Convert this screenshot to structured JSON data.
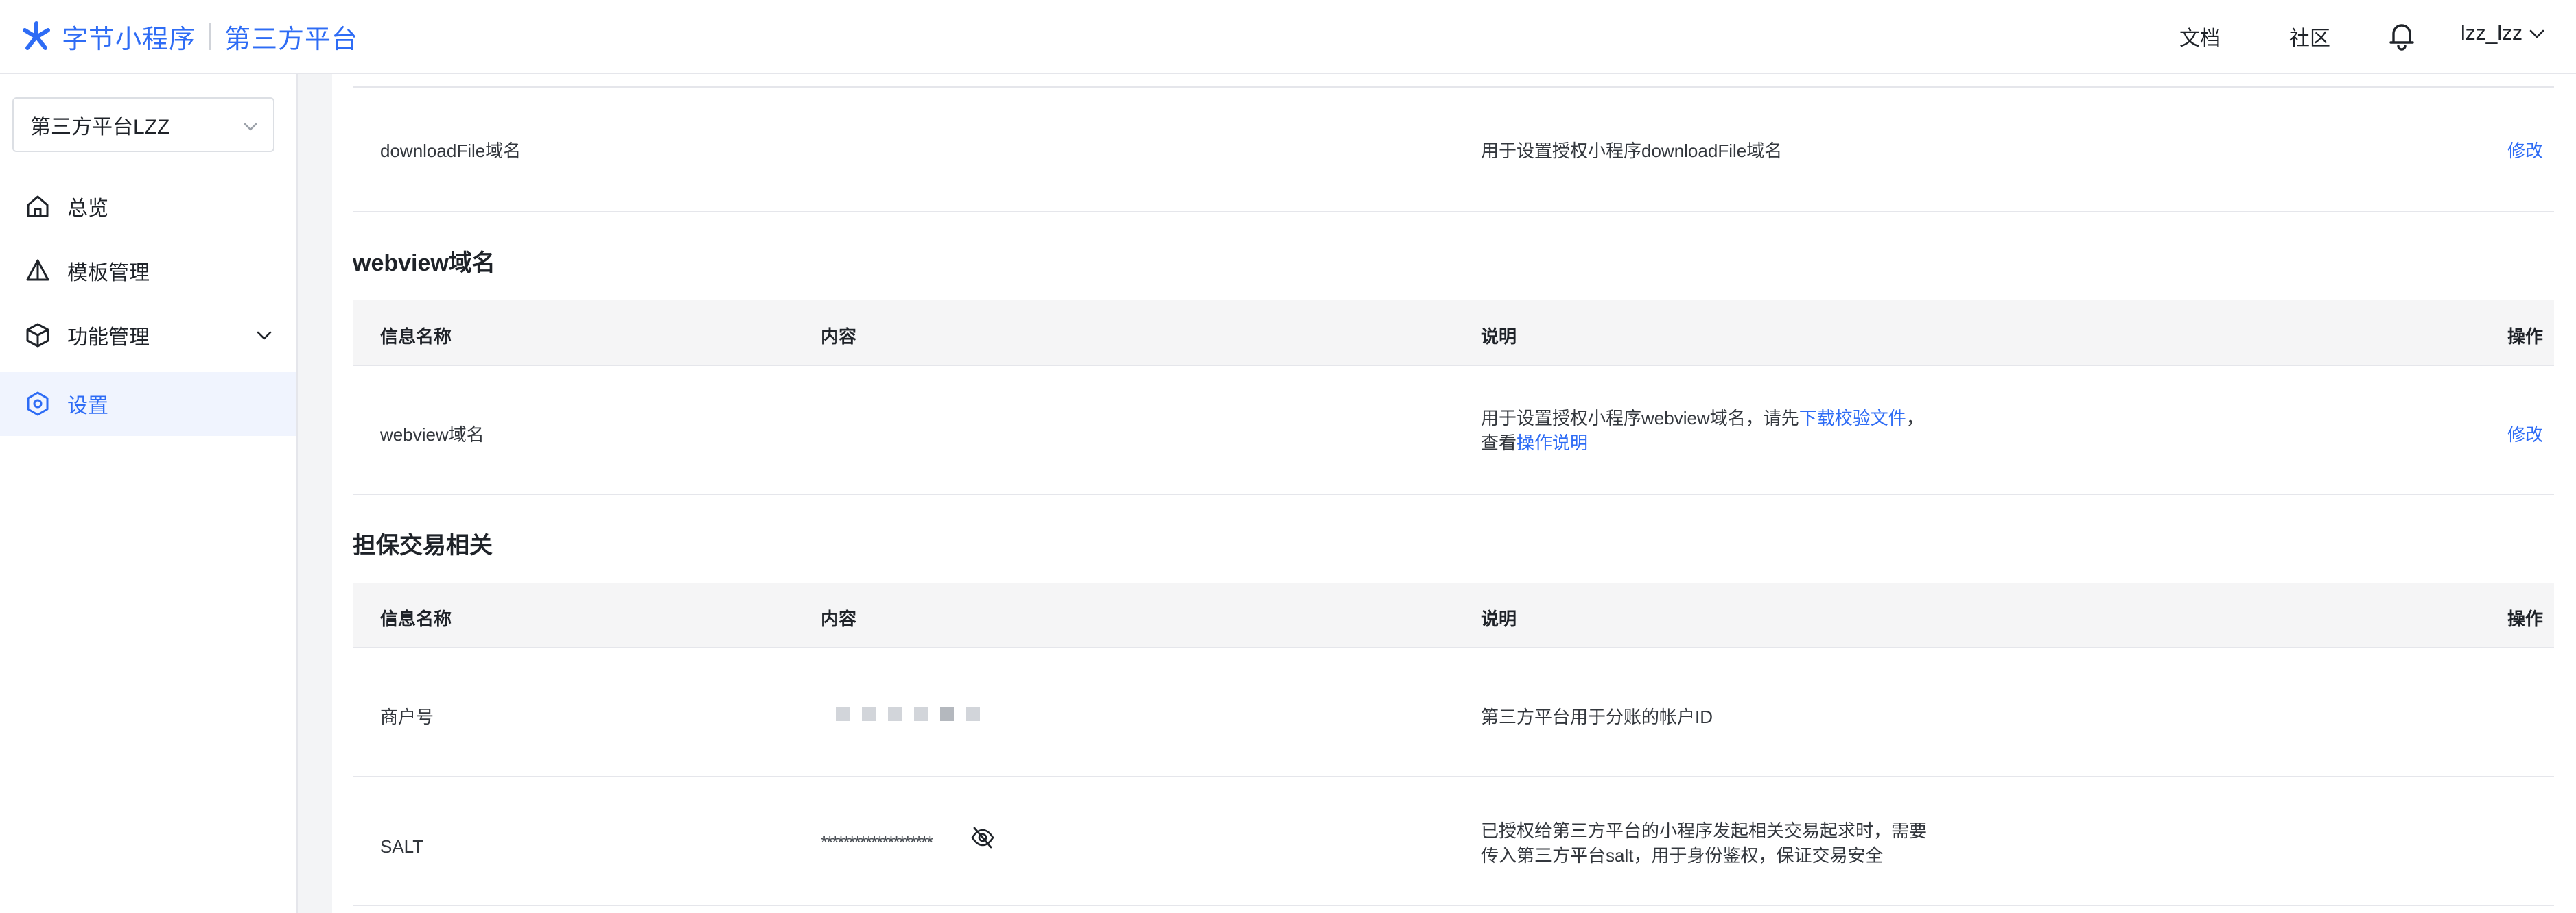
{
  "header": {
    "brand_name": "字节小程序",
    "brand_sub": "第三方平台",
    "links": {
      "docs": "文档",
      "community": "社区"
    },
    "user": "lzz_lzz",
    "icons": {
      "logo": "bytedance-logo-icon",
      "bell": "bell-icon",
      "user_menu": "chevron-down-icon"
    }
  },
  "sidebar": {
    "platform_select": "第三方平台LZZ",
    "items": [
      {
        "label": "总览",
        "icon": "home-icon"
      },
      {
        "label": "模板管理",
        "icon": "triangle-icon"
      },
      {
        "label": "功能管理",
        "icon": "cube-icon"
      },
      {
        "label": "设置",
        "icon": "gear-icon"
      }
    ],
    "accent_color": "#2e6cf5"
  },
  "main": {
    "download_row": {
      "name": "downloadFile域名",
      "desc": "用于设置授权小程序downloadFile域名",
      "action": "修改"
    },
    "webview": {
      "title": "webview域名",
      "columns": [
        "信息名称",
        "内容",
        "说明",
        "操作"
      ],
      "row": {
        "name": "webview域名",
        "desc_prefix": "用于设置授权小程序webview域名，请先",
        "desc_link1": "下载校验文件",
        "desc_mid": "，",
        "desc_line2_prefix": "查看",
        "desc_link2": "操作说明",
        "action": "修改"
      }
    },
    "escrow": {
      "title": "担保交易相关",
      "columns": [
        "信息名称",
        "内容",
        "说明",
        "操作"
      ],
      "merchant": {
        "name": "商户号",
        "desc": "第三方平台用于分账的帐户ID"
      },
      "salt": {
        "name": "SALT",
        "value": "********************",
        "desc_line1": "已授权给第三方平台的小程序发起相关交易起求时，需要",
        "desc_line2": "传入第三方平台salt，用于身份鉴权，保证交易安全"
      }
    }
  }
}
